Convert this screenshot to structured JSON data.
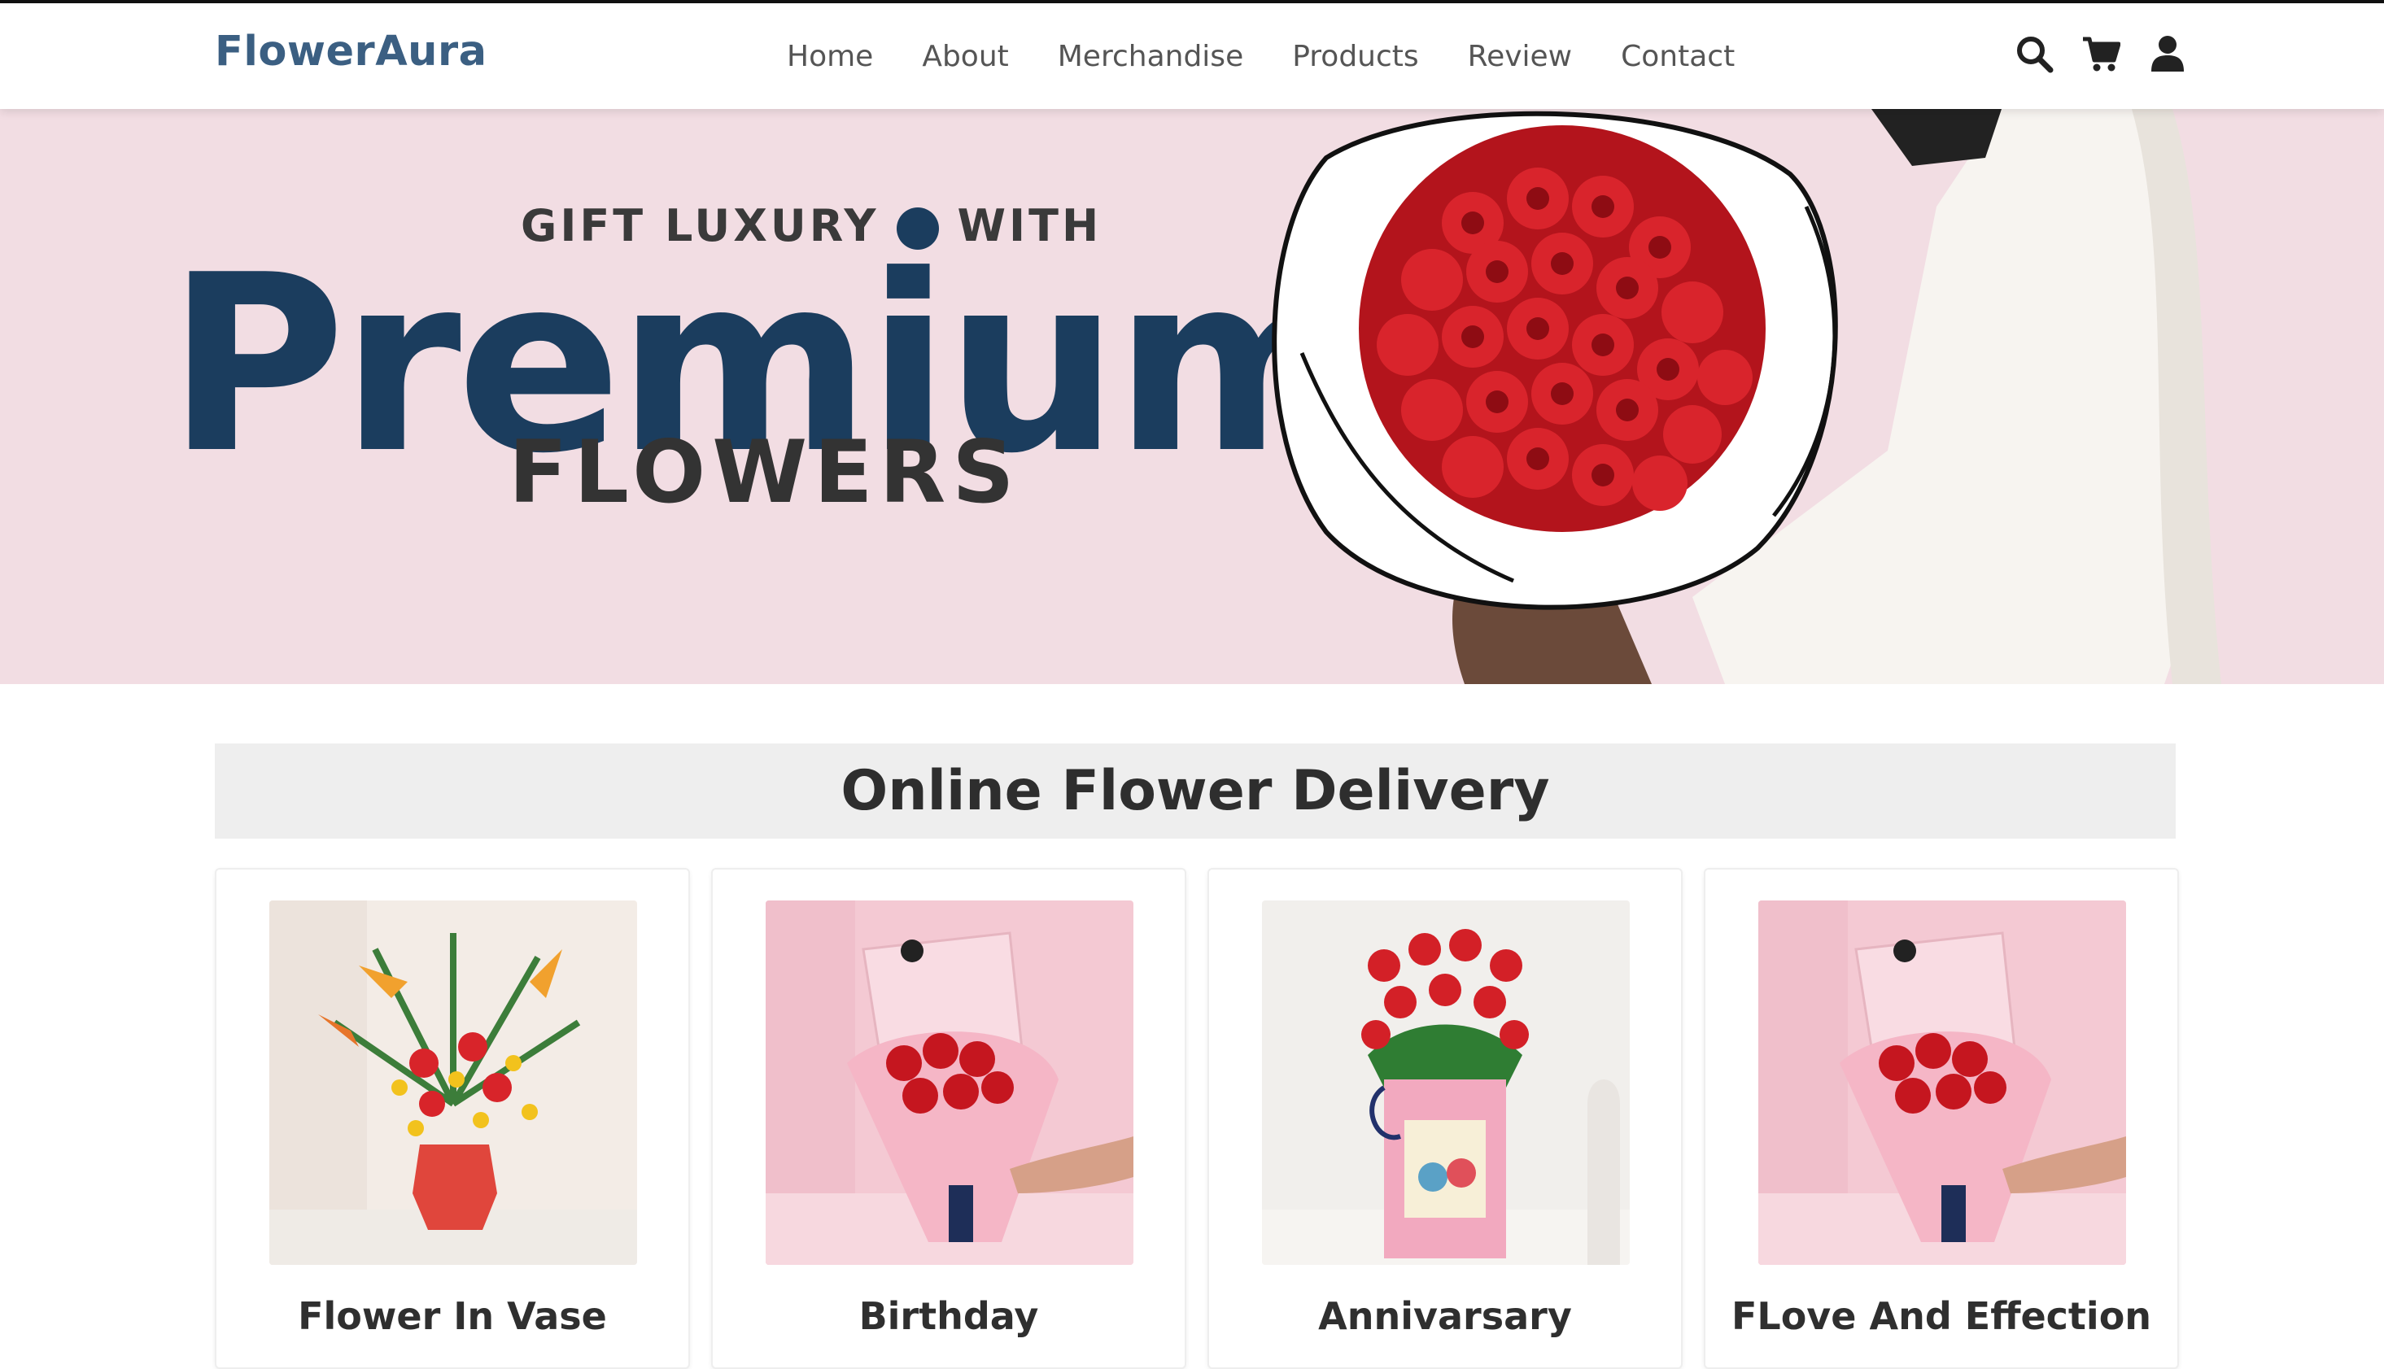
{
  "header": {
    "brand": "FlowerAura",
    "nav": [
      "Home",
      "About",
      "Merchandise",
      "Products",
      "Review",
      "Contact"
    ],
    "icons": [
      "search-icon",
      "cart-icon",
      "user-icon"
    ]
  },
  "hero": {
    "subtitle_left": "GIFT LUXURY",
    "subtitle_right": "WITH",
    "title": "Premium",
    "footer": "FLOWERS"
  },
  "section": {
    "title": "Online Flower Delivery",
    "cards": [
      {
        "label": "Flower In Vase"
      },
      {
        "label": "Birthday"
      },
      {
        "label": "Annivarsary"
      },
      {
        "label": "FLove And Effection"
      }
    ]
  },
  "colors": {
    "brand": "#3b5f82",
    "hero_bg": "#f2dde3",
    "hero_title": "#1b3d5e",
    "section_bg": "#eeeeee"
  }
}
